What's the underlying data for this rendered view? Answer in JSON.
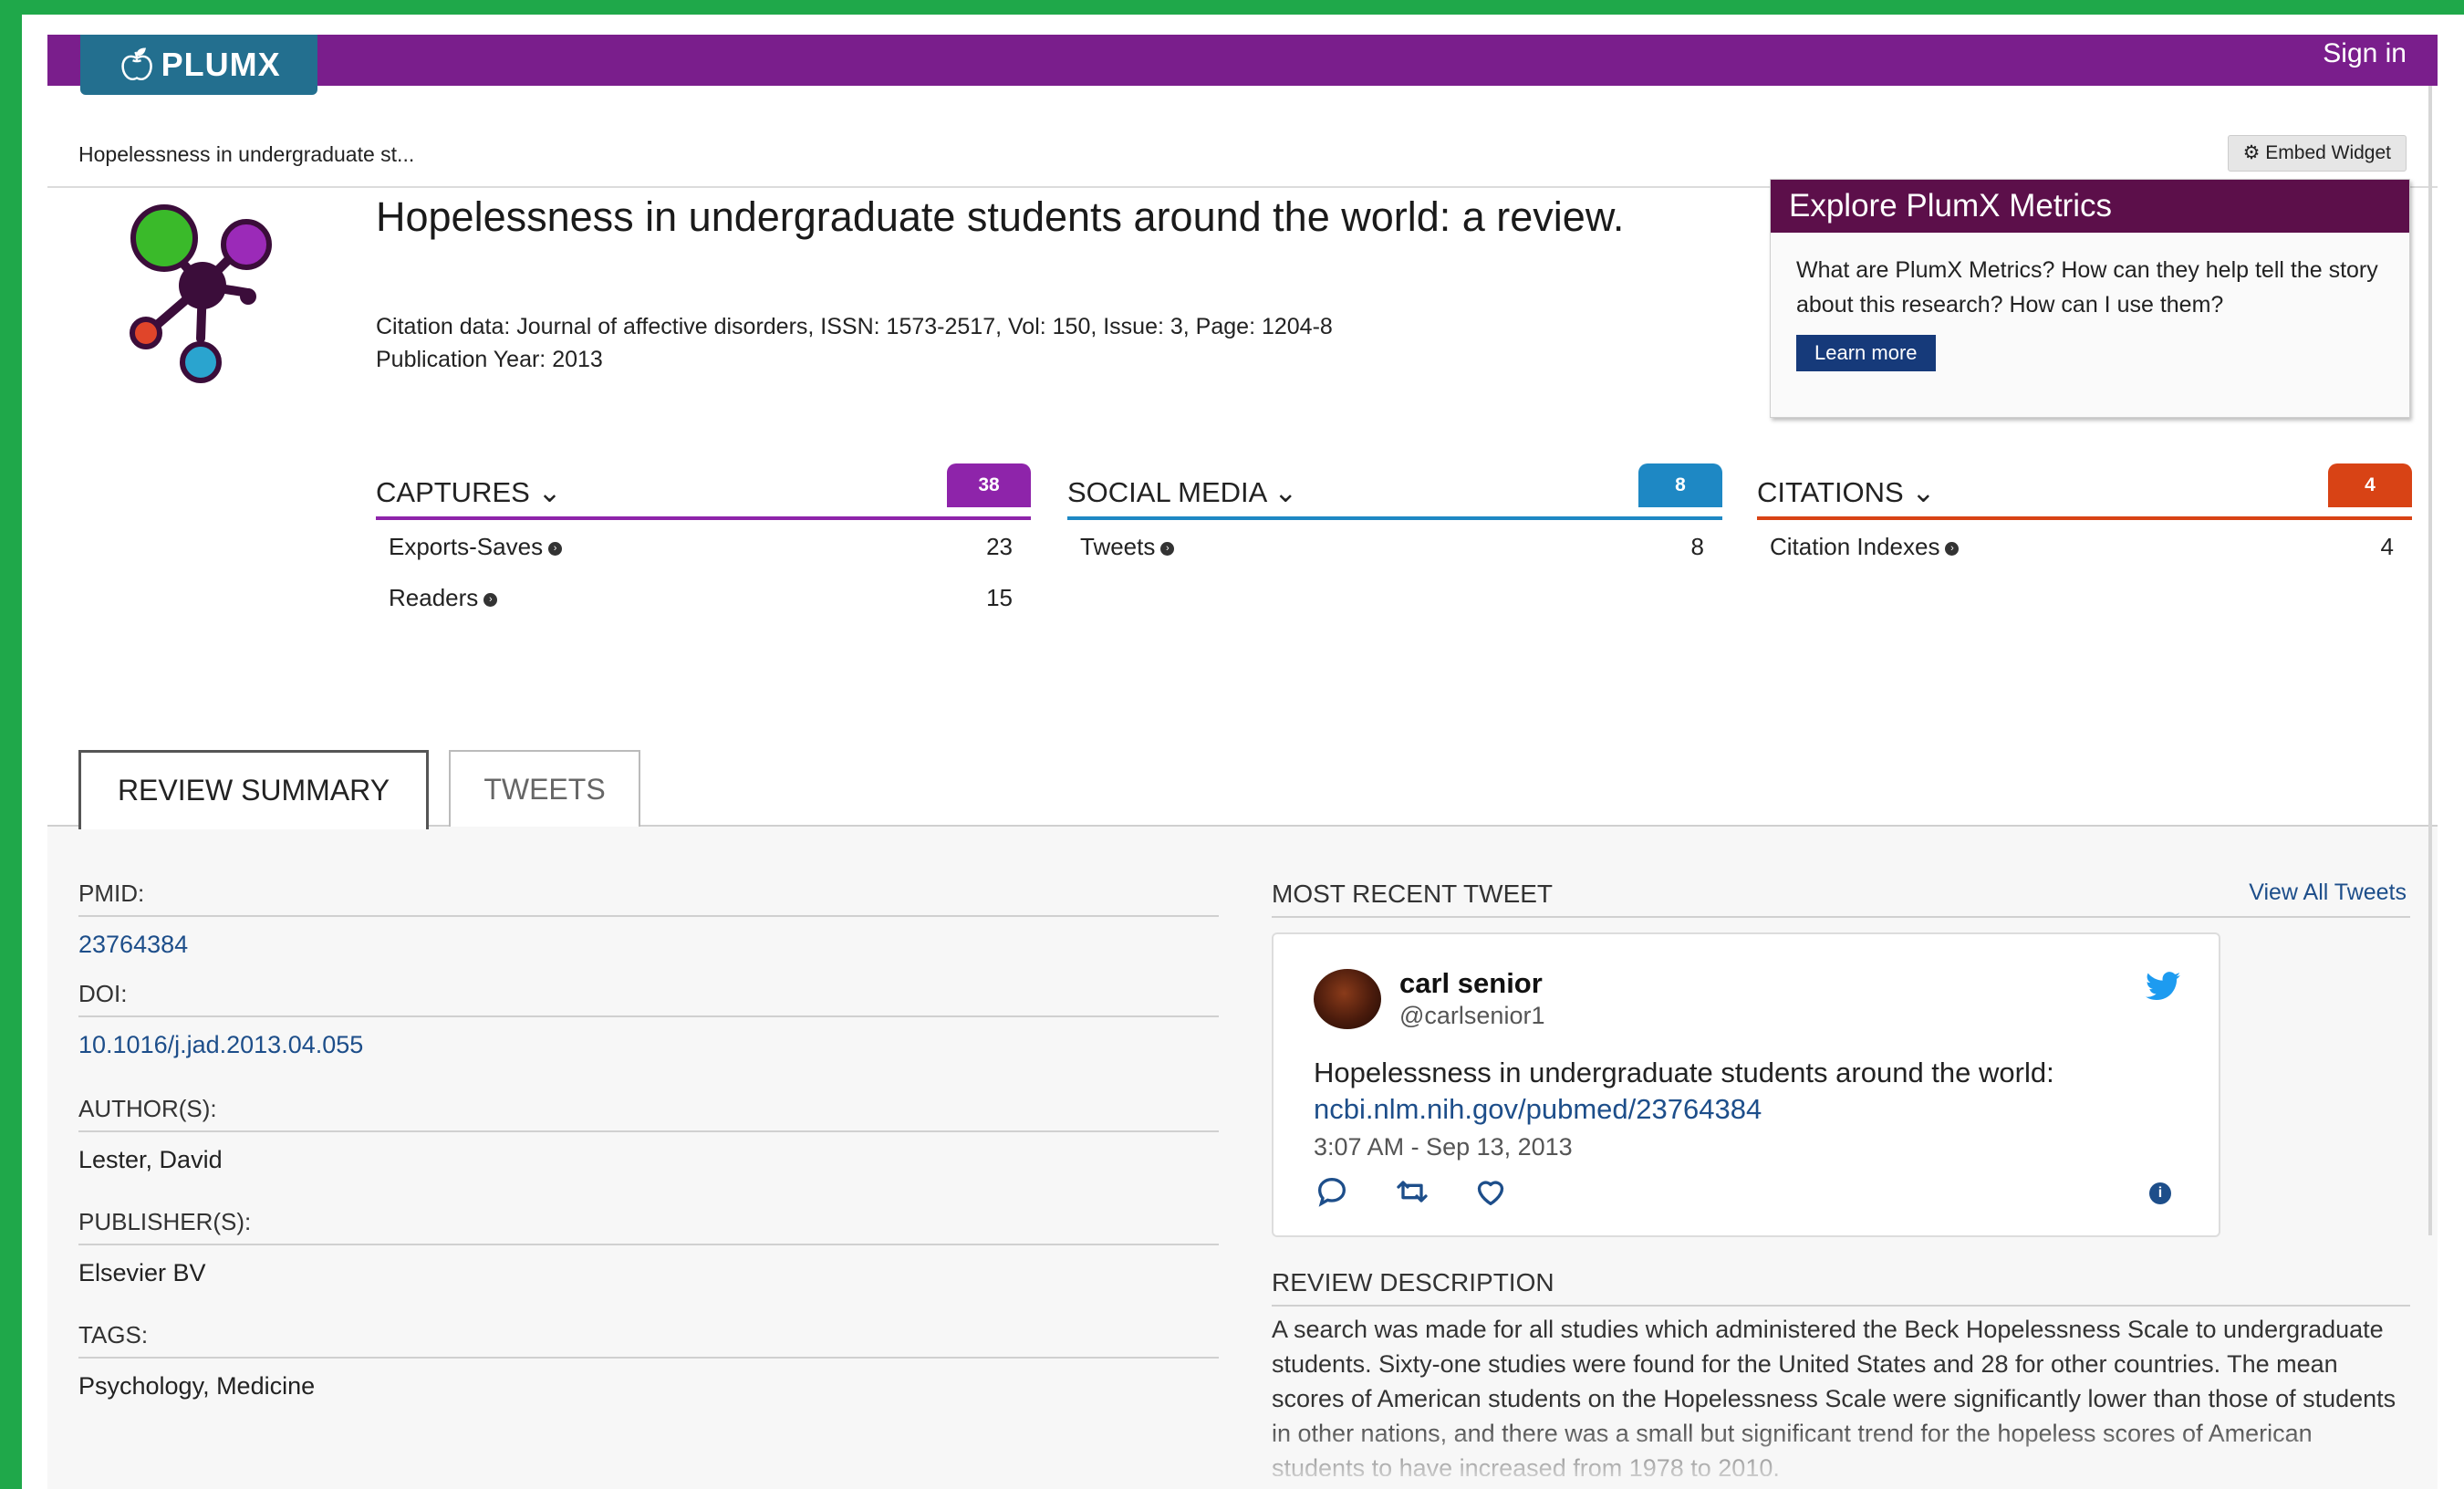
{
  "app": {
    "logo_text": "PLUMX",
    "sign_in": "Sign in"
  },
  "breadcrumb": "Hopelessness in undergraduate st...",
  "embed_widget": "Embed Widget",
  "article": {
    "title": "Hopelessness in undergraduate students around the world: a review.",
    "citation": "Citation data: Journal of affective disorders, ISSN: 1573-2517, Vol: 150, Issue: 3, Page: 1204-8",
    "year": "Publication Year: 2013"
  },
  "explore": {
    "heading": "Explore PlumX Metrics",
    "body": "What are PlumX Metrics? How can they help tell the story about this research? How can I use them?",
    "button": "Learn more"
  },
  "metrics": [
    {
      "label": "CAPTURES",
      "count": "38",
      "color": "#8e24aa",
      "rows": [
        {
          "name": "Exports-Saves",
          "value": "23"
        },
        {
          "name": "Readers",
          "value": "15"
        }
      ]
    },
    {
      "label": "SOCIAL MEDIA",
      "count": "8",
      "color": "#1e88c4",
      "rows": [
        {
          "name": "Tweets",
          "value": "8"
        }
      ]
    },
    {
      "label": "CITATIONS",
      "count": "4",
      "color": "#d84315",
      "rows": [
        {
          "name": "Citation Indexes",
          "value": "4"
        }
      ]
    }
  ],
  "tabs": [
    "REVIEW SUMMARY",
    "TWEETS"
  ],
  "summary": {
    "pmid_label": "PMID:",
    "pmid": "23764384",
    "doi_label": "DOI:",
    "doi": "10.1016/j.jad.2013.04.055",
    "authors_label": "AUTHOR(S):",
    "authors": "Lester, David",
    "publisher_label": "PUBLISHER(S):",
    "publisher": "Elsevier BV",
    "tags_label": "TAGS:",
    "tags": "Psychology, Medicine"
  },
  "tweet": {
    "section_title": "MOST RECENT TWEET",
    "view_all": "View All Tweets",
    "name": "carl senior",
    "handle": "@carlsenior1",
    "text": "Hopelessness in undergraduate students around the world:",
    "link": "ncbi.nlm.nih.gov/pubmed/23764384",
    "time": "3:07 AM - Sep 13, 2013"
  },
  "review": {
    "title": "REVIEW DESCRIPTION",
    "text": "A search was made for all studies which administered the Beck Hopelessness Scale to undergraduate students. Sixty-one studies were found for the United States and 28 for other countries. The mean scores of American students on the Hopelessness Scale were significantly lower than those of students in other nations, and there was a small but significant trend for the hopeless scores of American students to have increased from 1978 to 2010."
  }
}
